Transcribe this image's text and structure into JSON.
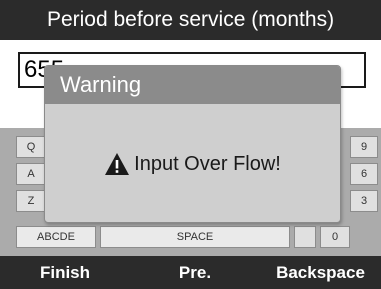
{
  "header": {
    "title": "Period before service (months)"
  },
  "input": {
    "value": "655"
  },
  "keyboard": {
    "left_keys": [
      "Q",
      "A",
      "Z"
    ],
    "right_keys": [
      "9",
      "6",
      "3",
      "0"
    ],
    "bottom_row": {
      "case_key": "ABCDE",
      "space_key": "SPACE"
    }
  },
  "dialog": {
    "title": "Warning",
    "message": "Input Over Flow!",
    "icon": "warning-triangle-icon"
  },
  "footer": {
    "finish_label": "Finish",
    "prev_label": "Pre.",
    "backspace_label": "Backspace"
  },
  "colors": {
    "bar_background": "#2b2b2b",
    "dialog_title": "#8b8b8b",
    "dialog_body": "#cfcfcf",
    "keyboard_background": "#ababab"
  }
}
